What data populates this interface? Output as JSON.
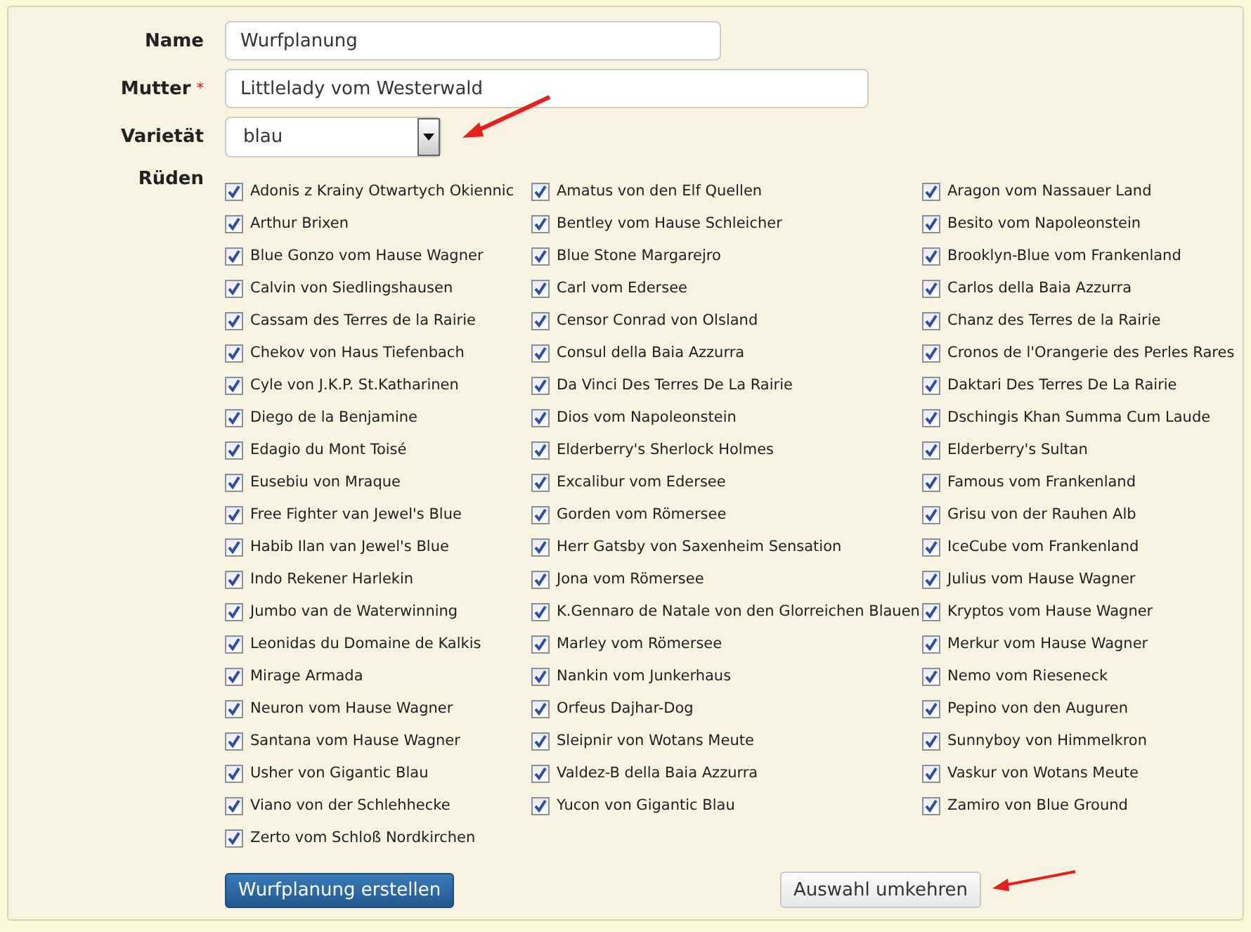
{
  "form": {
    "name": {
      "label": "Name",
      "value": "Wurfplanung"
    },
    "mother": {
      "label": "Mutter",
      "required_mark": "*",
      "value": "Littlelady vom Westerwald"
    },
    "variety": {
      "label": "Varietät",
      "value": "blau"
    },
    "males": {
      "label": "Rüden",
      "items": [
        {
          "label": "Adonis z Krainy Otwartych Okiennic",
          "checked": true
        },
        {
          "label": "Amatus von den Elf Quellen",
          "checked": true
        },
        {
          "label": "Aragon vom Nassauer Land",
          "checked": true
        },
        {
          "label": "Arthur Brixen",
          "checked": true
        },
        {
          "label": "Bentley vom Hause Schleicher",
          "checked": true
        },
        {
          "label": "Besito vom Napoleonstein",
          "checked": true
        },
        {
          "label": "Blue Gonzo vom Hause Wagner",
          "checked": true
        },
        {
          "label": "Blue Stone Margarejro",
          "checked": true
        },
        {
          "label": "Brooklyn-Blue vom Frankenland",
          "checked": true
        },
        {
          "label": "Calvin von Siedlingshausen",
          "checked": true
        },
        {
          "label": "Carl vom Edersee",
          "checked": true
        },
        {
          "label": "Carlos della Baia Azzurra",
          "checked": true
        },
        {
          "label": "Cassam des Terres de la Rairie",
          "checked": true
        },
        {
          "label": "Censor Conrad von Olsland",
          "checked": true
        },
        {
          "label": "Chanz des Terres de la Rairie",
          "checked": true
        },
        {
          "label": "Chekov von Haus Tiefenbach",
          "checked": true
        },
        {
          "label": "Consul della Baia Azzurra",
          "checked": true
        },
        {
          "label": "Cronos de l'Orangerie des Perles Rares",
          "checked": true
        },
        {
          "label": "Cyle von J.K.P. St.Katharinen",
          "checked": true
        },
        {
          "label": "Da Vinci Des Terres De La Rairie",
          "checked": true
        },
        {
          "label": "Daktari Des Terres De La Rairie",
          "checked": true
        },
        {
          "label": "Diego de la Benjamine",
          "checked": true
        },
        {
          "label": "Dios vom Napoleonstein",
          "checked": true
        },
        {
          "label": "Dschingis Khan Summa Cum Laude",
          "checked": true
        },
        {
          "label": "Edagio du Mont Toisé",
          "checked": true
        },
        {
          "label": "Elderberry's Sherlock Holmes",
          "checked": true
        },
        {
          "label": "Elderberry's Sultan",
          "checked": true
        },
        {
          "label": "Eusebiu von Mraque",
          "checked": true
        },
        {
          "label": "Excalibur vom Edersee",
          "checked": true
        },
        {
          "label": "Famous vom Frankenland",
          "checked": true
        },
        {
          "label": "Free Fighter van Jewel's Blue",
          "checked": true
        },
        {
          "label": "Gorden vom Römersee",
          "checked": true
        },
        {
          "label": "Grisu von der Rauhen Alb",
          "checked": true
        },
        {
          "label": "Habib Ilan van Jewel's Blue",
          "checked": true
        },
        {
          "label": "Herr Gatsby von Saxenheim Sensation",
          "checked": true
        },
        {
          "label": "IceCube vom Frankenland",
          "checked": true
        },
        {
          "label": "Indo Rekener Harlekin",
          "checked": true
        },
        {
          "label": "Jona vom Römersee",
          "checked": true
        },
        {
          "label": "Julius vom Hause Wagner",
          "checked": true
        },
        {
          "label": "Jumbo van de Waterwinning",
          "checked": true
        },
        {
          "label": "K.Gennaro de Natale von den Glorreichen Blauen",
          "checked": true
        },
        {
          "label": "Kryptos vom Hause Wagner",
          "checked": true
        },
        {
          "label": "Leonidas du Domaine de Kalkis",
          "checked": true
        },
        {
          "label": "Marley vom Römersee",
          "checked": true
        },
        {
          "label": "Merkur vom Hause Wagner",
          "checked": true
        },
        {
          "label": "Mirage Armada",
          "checked": true
        },
        {
          "label": "Nankin vom Junkerhaus",
          "checked": true
        },
        {
          "label": "Nemo vom Rieseneck",
          "checked": true
        },
        {
          "label": "Neuron vom Hause Wagner",
          "checked": true
        },
        {
          "label": "Orfeus Dajhar-Dog",
          "checked": true
        },
        {
          "label": "Pepino von den Auguren",
          "checked": true
        },
        {
          "label": "Santana vom Hause Wagner",
          "checked": true
        },
        {
          "label": "Sleipnir von Wotans Meute",
          "checked": true
        },
        {
          "label": "Sunnyboy von Himmelkron",
          "checked": true
        },
        {
          "label": "Usher von Gigantic Blau",
          "checked": true
        },
        {
          "label": "Valdez-B della Baia Azzurra",
          "checked": true
        },
        {
          "label": "Vaskur von Wotans Meute",
          "checked": true
        },
        {
          "label": "Viano von der Schlehhecke",
          "checked": true
        },
        {
          "label": "Yucon von Gigantic Blau",
          "checked": true
        },
        {
          "label": "Zamiro von Blue Ground",
          "checked": true
        },
        {
          "label": "Zerto vom Schloß Nordkirchen",
          "checked": true
        }
      ]
    },
    "submit_button": "Wurfplanung erstellen",
    "invert_button": "Auswahl umkehren"
  }
}
